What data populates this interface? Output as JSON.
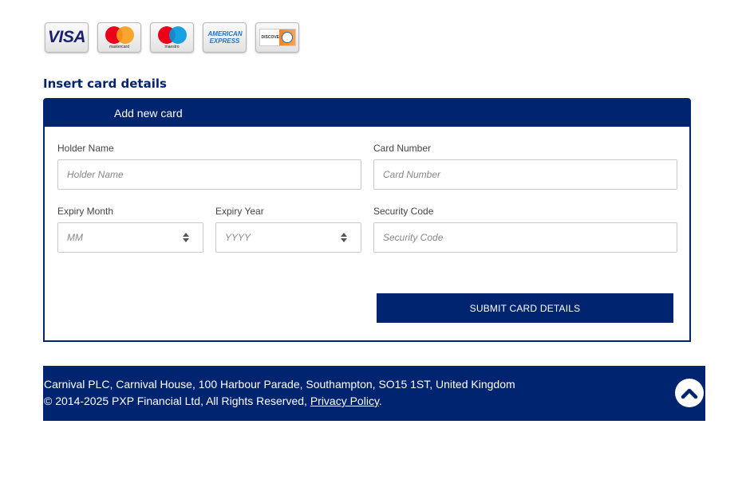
{
  "card_logos": [
    {
      "name": "Visa",
      "text": "VISA",
      "icon": "visa-logo-icon"
    },
    {
      "name": "Mastercard",
      "text": "mastercard",
      "icon": "mastercard-logo-icon"
    },
    {
      "name": "Maestro",
      "text": "maestro",
      "icon": "maestro-logo-icon"
    },
    {
      "name": "American Express",
      "text": "AMERICAN EXPRESS",
      "icon": "amex-logo-icon"
    },
    {
      "name": "Discover / Diners Club",
      "text": "DISCOVER",
      "icon": "discover-diners-logo-icon"
    }
  ],
  "colors": {
    "brand": "#002470",
    "mastercard_red": "#eb001b",
    "mastercard_orange": "#f79e1b",
    "maestro_red": "#eb001b",
    "maestro_blue": "#0099df",
    "visa_blue": "#1a1f71"
  },
  "section_title": "Insert card details",
  "panel": {
    "header": "Add new card"
  },
  "form": {
    "holder_name": {
      "label": "Holder Name",
      "placeholder": "Holder Name",
      "value": ""
    },
    "card_number": {
      "label": "Card Number",
      "placeholder": "Card Number",
      "value": ""
    },
    "expiry_month": {
      "label": "Expiry Month",
      "placeholder": "MM"
    },
    "expiry_year": {
      "label": "Expiry Year",
      "placeholder": "YYYY"
    },
    "security_code": {
      "label": "Security Code",
      "placeholder": "Security Code",
      "value": ""
    },
    "submit_label": "SUBMIT CARD DETAILS"
  },
  "footer": {
    "address": "Carnival PLC, Carnival House, 100 Harbour Parade, Southampton, SO15 1ST, United Kingdom",
    "copyright": "© 2014-2025 PXP Financial Ltd, All Rights Reserved, ",
    "privacy_link": "Privacy Policy",
    "trailing": ".",
    "back_to_top_icon": "chevron-up-icon"
  }
}
